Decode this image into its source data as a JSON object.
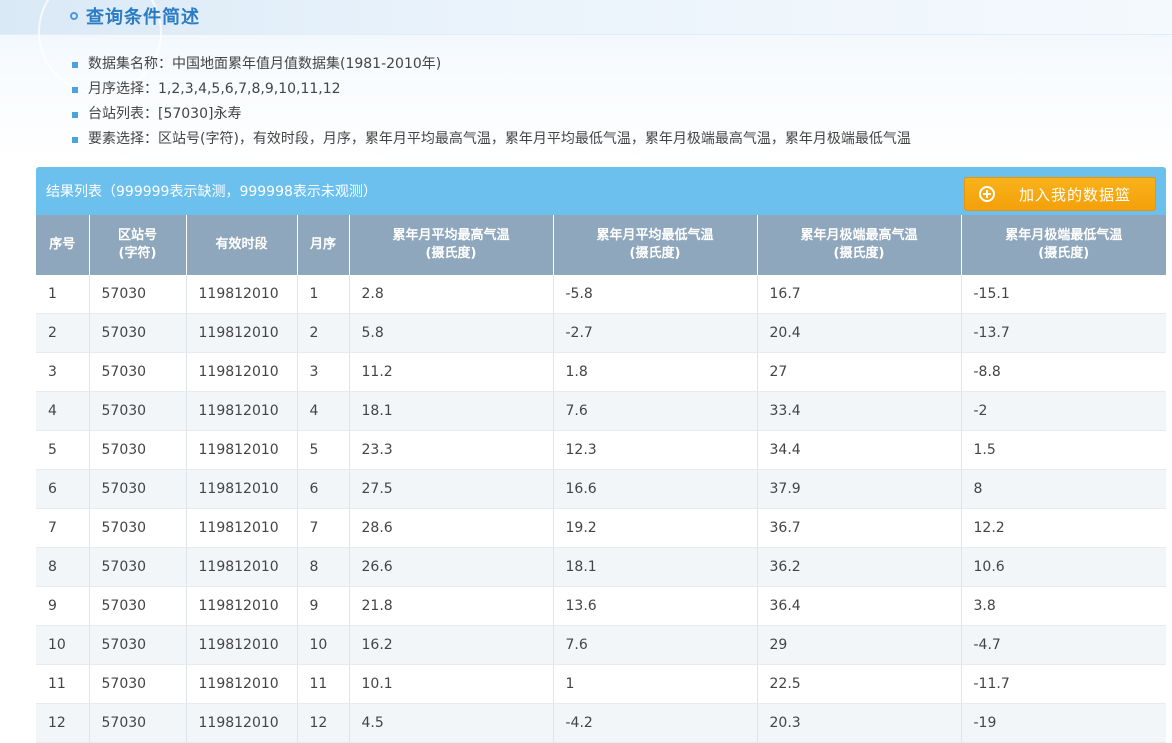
{
  "header": {
    "title": "查询条件简述"
  },
  "criteria": [
    {
      "label": "数据集名称",
      "value": "中国地面累年值月值数据集(1981-2010年)"
    },
    {
      "label": "月序选择",
      "value": "1,2,3,4,5,6,7,8,9,10,11,12"
    },
    {
      "label": "台站列表",
      "value": "[57030]永寿"
    },
    {
      "label": "要素选择",
      "value": "区站号(字符)，有效时段，月序，累年月平均最高气温，累年月平均最低气温，累年月极端最高气温，累年月极端最低气温"
    }
  ],
  "criteria_text": [
    "数据集名称：中国地面累年值月值数据集(1981-2010年)",
    "月序选择：1,2,3,4,5,6,7,8,9,10,11,12",
    "台站列表：[57030]永寿",
    "要素选择：区站号(字符)，有效时段，月序，累年月平均最高气温，累年月平均最低气温，累年月极端最高气温，累年月极端最低气温"
  ],
  "result": {
    "title": "结果列表（999999表示缺测，999998表示未观测）",
    "add_button_label": "加入我的数据篮"
  },
  "table": {
    "headers": [
      {
        "line1": "序号",
        "line2": ""
      },
      {
        "line1": "区站号",
        "line2": "(字符)"
      },
      {
        "line1": "有效时段",
        "line2": ""
      },
      {
        "line1": "月序",
        "line2": ""
      },
      {
        "line1": "累年月平均最高气温",
        "line2": "(摄氏度)"
      },
      {
        "line1": "累年月平均最低气温",
        "line2": "(摄氏度)"
      },
      {
        "line1": "累年月极端最高气温",
        "line2": "(摄氏度)"
      },
      {
        "line1": "累年月极端最低气温",
        "line2": "(摄氏度)"
      }
    ],
    "rows": [
      [
        "1",
        "57030",
        "119812010",
        "1",
        "2.8",
        "-5.8",
        "16.7",
        "-15.1"
      ],
      [
        "2",
        "57030",
        "119812010",
        "2",
        "5.8",
        "-2.7",
        "20.4",
        "-13.7"
      ],
      [
        "3",
        "57030",
        "119812010",
        "3",
        "11.2",
        "1.8",
        "27",
        "-8.8"
      ],
      [
        "4",
        "57030",
        "119812010",
        "4",
        "18.1",
        "7.6",
        "33.4",
        "-2"
      ],
      [
        "5",
        "57030",
        "119812010",
        "5",
        "23.3",
        "12.3",
        "34.4",
        "1.5"
      ],
      [
        "6",
        "57030",
        "119812010",
        "6",
        "27.5",
        "16.6",
        "37.9",
        "8"
      ],
      [
        "7",
        "57030",
        "119812010",
        "7",
        "28.6",
        "19.2",
        "36.7",
        "12.2"
      ],
      [
        "8",
        "57030",
        "119812010",
        "8",
        "26.6",
        "18.1",
        "36.2",
        "10.6"
      ],
      [
        "9",
        "57030",
        "119812010",
        "9",
        "21.8",
        "13.6",
        "36.4",
        "3.8"
      ],
      [
        "10",
        "57030",
        "119812010",
        "10",
        "16.2",
        "7.6",
        "29",
        "-4.7"
      ],
      [
        "11",
        "57030",
        "119812010",
        "11",
        "10.1",
        "1",
        "22.5",
        "-11.7"
      ],
      [
        "12",
        "57030",
        "119812010",
        "12",
        "4.5",
        "-4.2",
        "20.3",
        "-19"
      ]
    ]
  },
  "colors": {
    "accent": "#2b7cc4",
    "result_bar": "#6cc0ee",
    "table_header": "#8fa7bc",
    "add_button": "#f4a00a"
  }
}
